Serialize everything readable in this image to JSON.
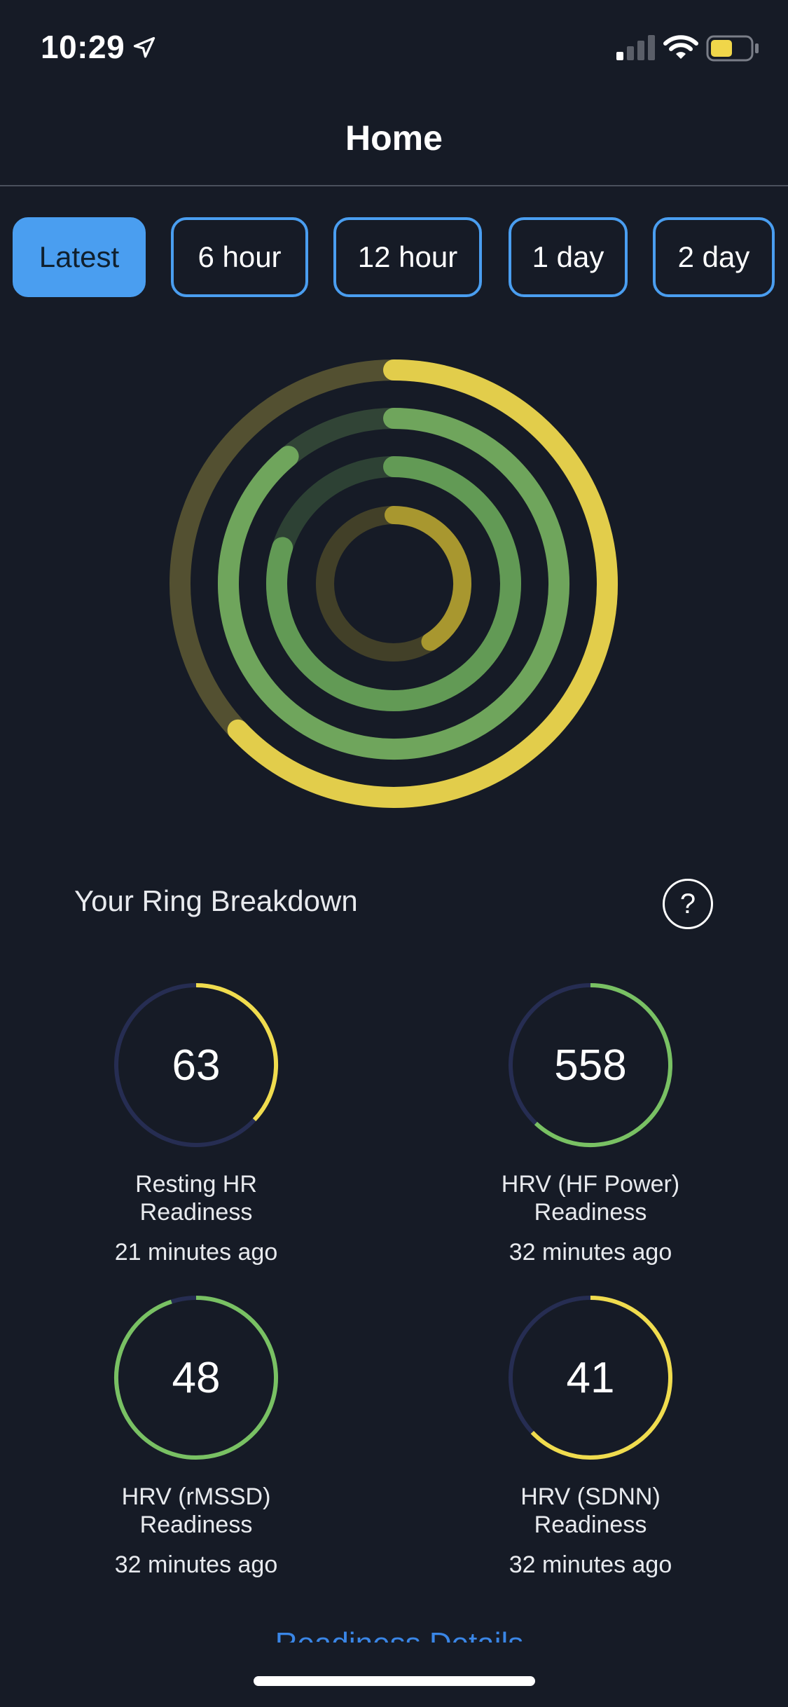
{
  "status_bar": {
    "time": "10:29",
    "location_icon": "location-arrow-icon",
    "signal_icon": "cellular-signal-icon",
    "wifi_icon": "wifi-icon",
    "battery_icon": "battery-icon",
    "battery_color": "#f0d64a"
  },
  "nav": {
    "title": "Home"
  },
  "range_tabs": [
    {
      "label": "Latest",
      "active": true
    },
    {
      "label": "6 hour",
      "active": false
    },
    {
      "label": "12 hour",
      "active": false
    },
    {
      "label": "1 day",
      "active": false
    },
    {
      "label": "2 day",
      "active": false
    }
  ],
  "overview_rings": [
    {
      "level": 0.63,
      "color": "#e2cd4b"
    },
    {
      "level": 0.89,
      "color": "#6fa55c"
    },
    {
      "level": 0.8,
      "color": "#629a55"
    },
    {
      "level": 0.41,
      "color": "#a8972f"
    }
  ],
  "breakdown": {
    "title": "Your Ring Breakdown",
    "help_label": "?",
    "help_icon": "question-icon",
    "metrics": [
      {
        "value": "63",
        "label_line1": "Resting HR",
        "label_line2": "Readiness",
        "time": "21 minutes ago",
        "level": 0.37,
        "color": "#f0dc4e"
      },
      {
        "value": "558",
        "label_line1": "HRV (HF Power)",
        "label_line2": "Readiness",
        "time": "32 minutes ago",
        "level": 0.62,
        "color": "#79c163"
      },
      {
        "value": "48",
        "label_line1": "HRV (rMSSD)",
        "label_line2": "Readiness",
        "time": "32 minutes ago",
        "level": 0.95,
        "color": "#79c163"
      },
      {
        "value": "41",
        "label_line1": "HRV (SDNN)",
        "label_line2": "Readiness",
        "time": "32 minutes ago",
        "level": 0.63,
        "color": "#f0dc4e"
      }
    ]
  },
  "footer_link": "Readiness Details",
  "colors": {
    "background": "#161b26",
    "accent": "#4a9ef0",
    "ring_track_dark": "#262d52"
  }
}
